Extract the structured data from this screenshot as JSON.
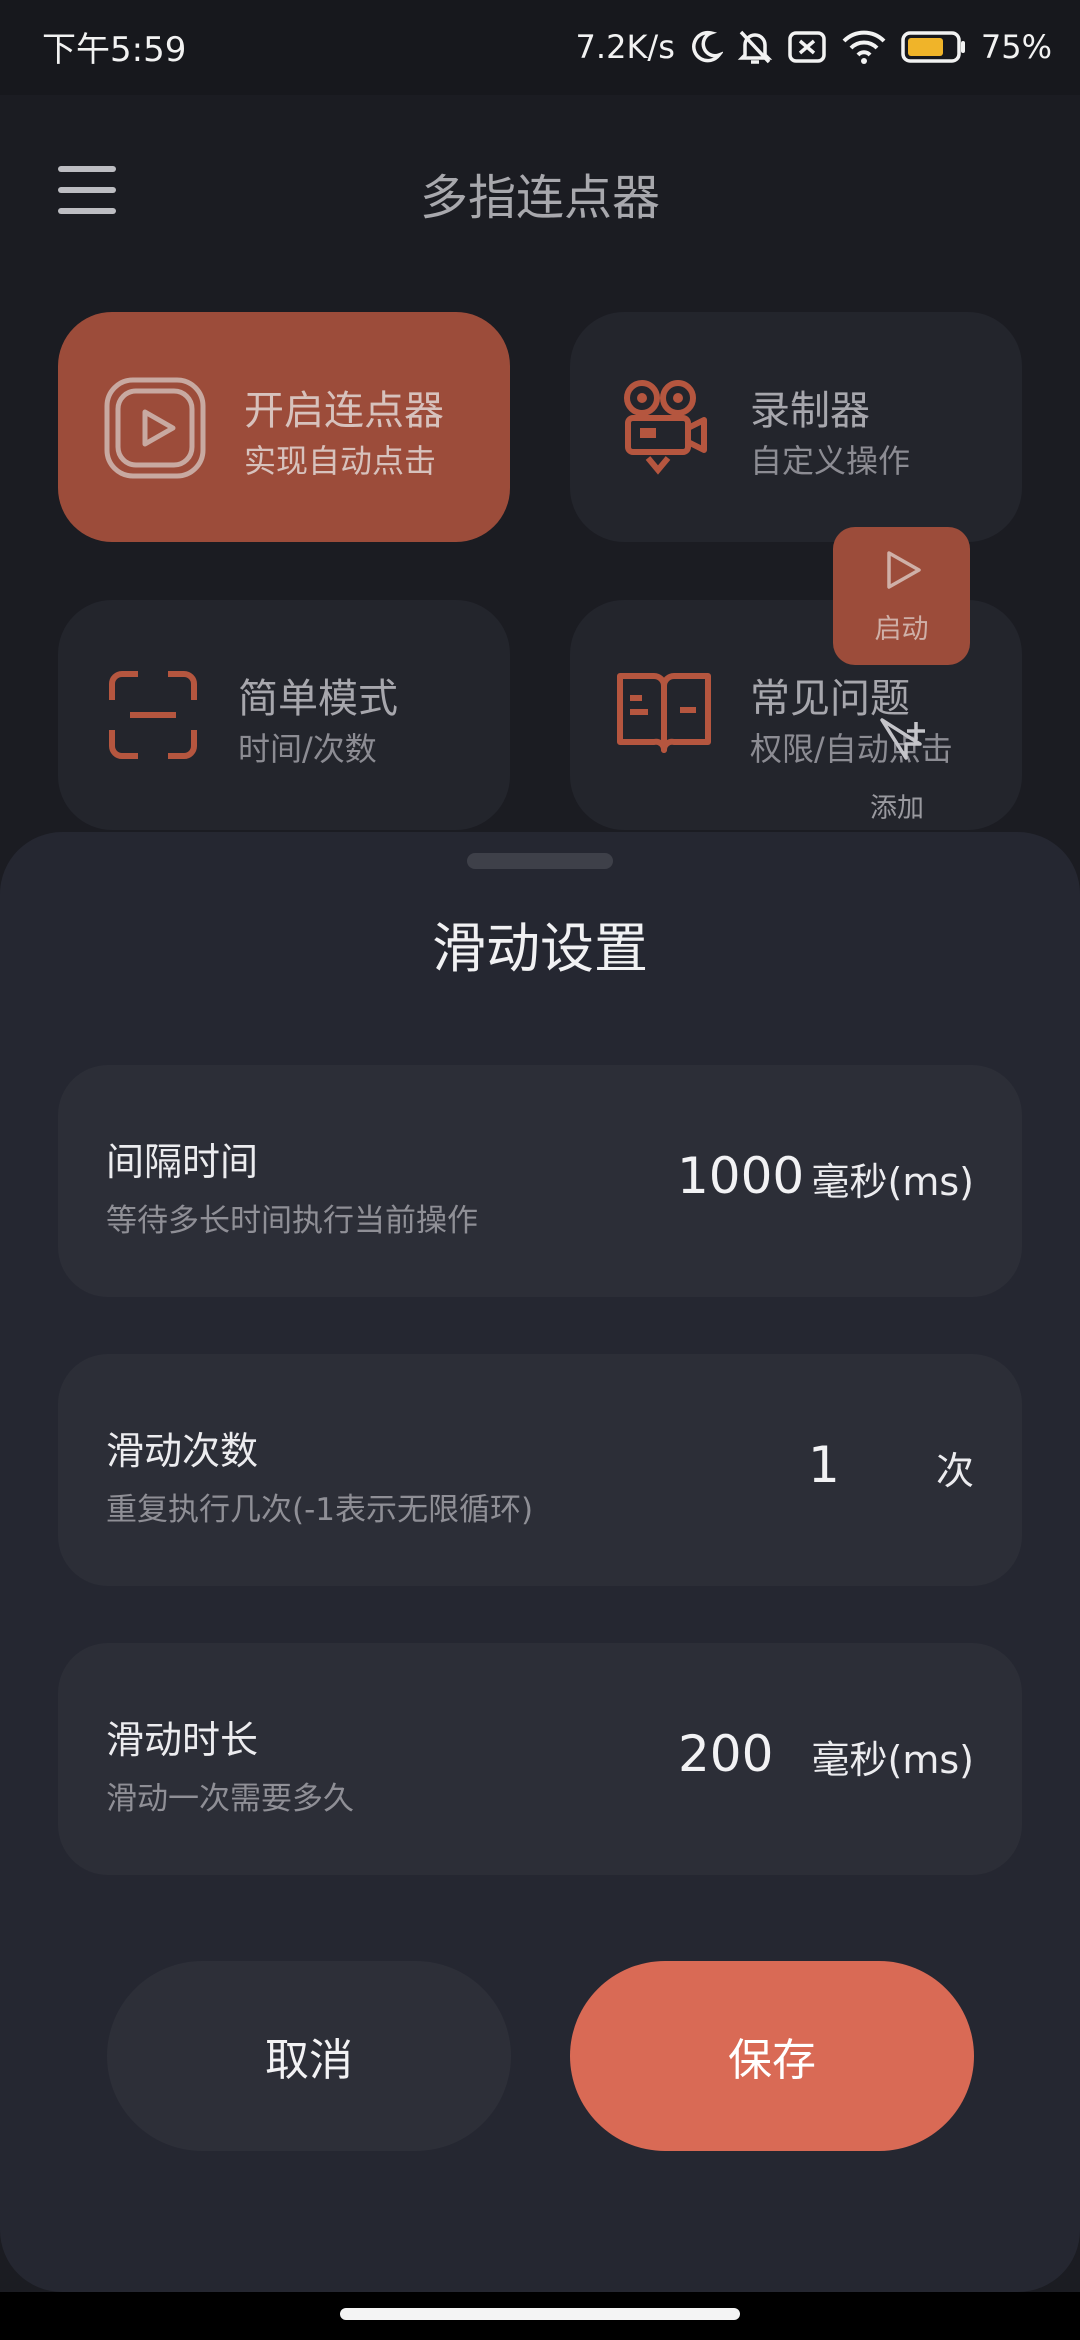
{
  "status_bar": {
    "time": "下午5:59",
    "network_speed": "7.2K/s",
    "battery_percent": "75%",
    "battery_level": 0.75,
    "icons": [
      "moon-icon",
      "mute-bell-icon",
      "sim-x-icon",
      "wifi-icon",
      "battery-icon"
    ]
  },
  "header": {
    "title": "多指连点器",
    "menu_icon": "hamburger-menu-icon"
  },
  "cards": [
    {
      "title": "开启连点器",
      "subtitle": "实现自动点击",
      "icon": "play-icon",
      "active": true
    },
    {
      "title": "录制器",
      "subtitle": "自定义操作",
      "icon": "camera-icon",
      "active": false
    },
    {
      "title": "简单模式",
      "subtitle": "时间/次数",
      "icon": "scan-icon",
      "active": false
    },
    {
      "title": "常见问题",
      "subtitle": "权限/自动点击",
      "icon": "book-icon",
      "active": false
    }
  ],
  "floating_widget": {
    "start_label": "启动",
    "add_label": "添加"
  },
  "sheet": {
    "title": "滑动设置",
    "rows": [
      {
        "title": "间隔时间",
        "description": "等待多长时间执行当前操作",
        "value": "1000",
        "unit": "毫秒(ms)"
      },
      {
        "title": "滑动次数",
        "description": "重复执行几次(-1表示无限循环)",
        "value": "1",
        "unit": "次"
      },
      {
        "title": "滑动时长",
        "description": "滑动一次需要多久",
        "value": "200",
        "unit": "毫秒(ms)"
      }
    ],
    "cancel_label": "取消",
    "save_label": "保存"
  },
  "colors": {
    "accent": "#d96a55",
    "accent_dim": "#9c4c3a",
    "background": "#1b1c22",
    "sheet": "#252731"
  }
}
